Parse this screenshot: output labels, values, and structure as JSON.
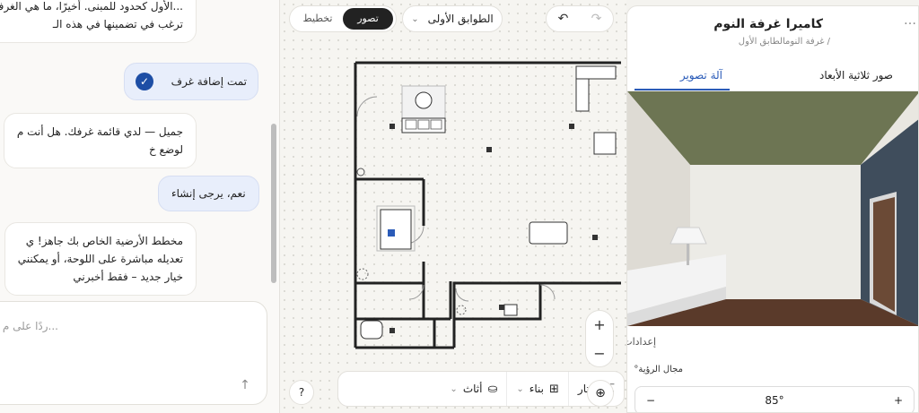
{
  "chat": {
    "messages": [
      {
        "role": "ai",
        "lines": [
          "...الأول كحدود للمبنى. أخيرًا، ما هي الغرف",
          "ترغب في تضمينها في هذه الـ"
        ]
      },
      {
        "role": "status",
        "text": "تمت إضافة غرف"
      },
      {
        "role": "ai",
        "lines": [
          "جميل — لدي قائمة غرفك. هل أنت م",
          "لوضع خ"
        ]
      },
      {
        "role": "user",
        "text": "نعم، يرجى إنشاء"
      },
      {
        "role": "ai",
        "lines": [
          "مخطط الأرضية الخاص بك جاهز! ي",
          "تعديله مباشرة على اللوحة، أو يمكنني",
          "خيار جديد – فقط أخبرني"
        ]
      }
    ],
    "input_placeholder": "...ردًا على م"
  },
  "canvas": {
    "modes": [
      "تصور",
      "تخطيط"
    ],
    "active_mode": "تصور",
    "floor": "الطوابق الأولى",
    "toolbar": [
      {
        "icon": "cursor-icon",
        "label": "يختار"
      },
      {
        "icon": "grid-icon",
        "label": "بناء"
      },
      {
        "icon": "sofa-icon",
        "label": "أثاث"
      }
    ],
    "help": "?"
  },
  "panel": {
    "title": "كاميرا غرفة النوم",
    "breadcrumb": "/ غرفة النومالطابق الأول",
    "tabs": [
      "صور ثلاثية الأبعاد",
      "آلة تصوير"
    ],
    "active_tab": "آلة تصوير",
    "settings_heading": "إعدادات",
    "fov_label": "مجال الرؤية°",
    "fov_value": "85°"
  },
  "colors": {
    "accent": "#2a5bb8",
    "ceiling": "#6d7553",
    "floor": "#5a3a2a",
    "wall": "#e7e5df"
  }
}
